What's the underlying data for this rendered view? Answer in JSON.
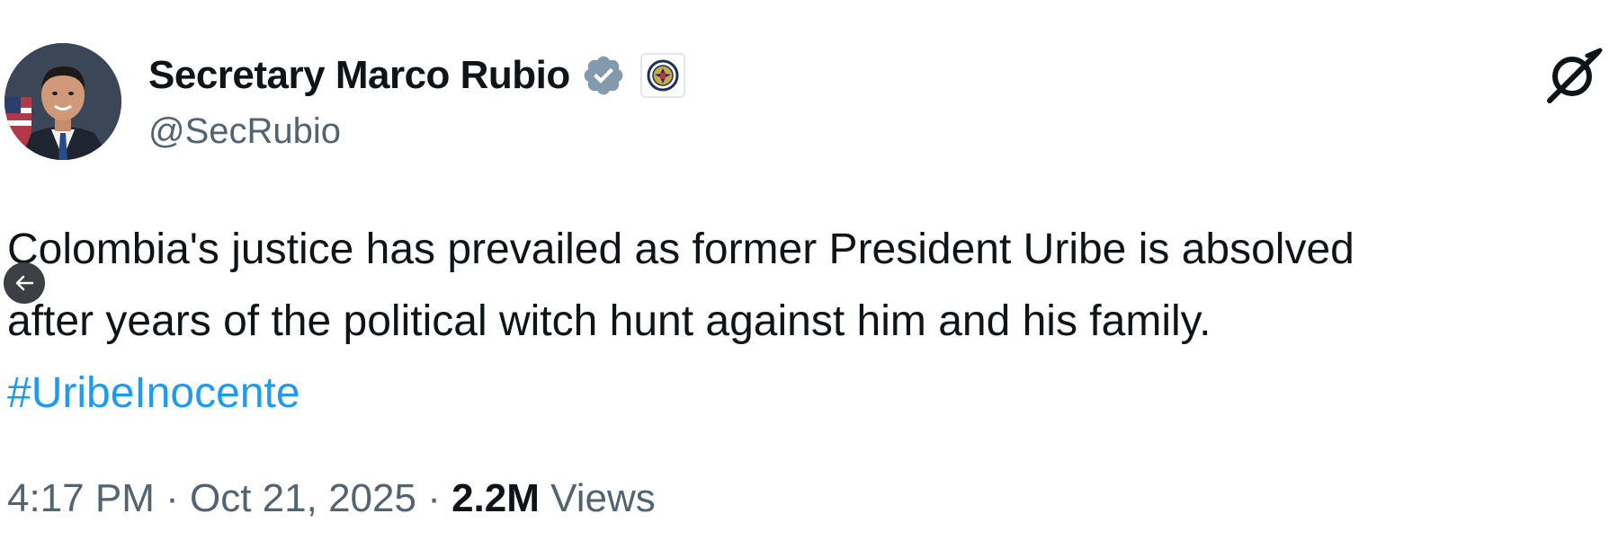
{
  "author": {
    "display_name": "Secretary Marco Rubio",
    "handle": "@SecRubio",
    "avatar_icon": "avatar-photo",
    "verified_icon": "verified-badge-icon",
    "verified_color": "#829aab",
    "affiliation_icon": "state-department-seal-icon"
  },
  "tweet": {
    "lines": [
      "Colombia's justice has prevailed as former President Uribe is absolved",
      "after years of the political witch hunt against him and his family."
    ],
    "hashtag": "#UribeInocente",
    "hashtag_color": "#1d9bf0"
  },
  "meta": {
    "time": "4:17 PM",
    "separator": "·",
    "date": "Oct 21, 2025",
    "views_count": "2.2M",
    "views_label": "Views"
  },
  "controls": {
    "grok_icon": "grok-icon",
    "back_icon": "arrow-left-icon"
  }
}
